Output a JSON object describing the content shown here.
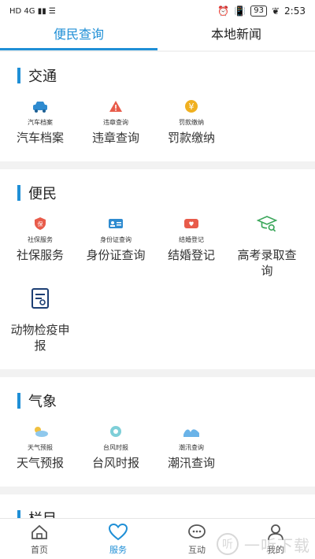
{
  "status": {
    "left": "HD 4G ▮▮ ☰",
    "time": "2:53",
    "battery": "93"
  },
  "tabs": [
    {
      "label": "便民查询",
      "active": true
    },
    {
      "label": "本地新闻",
      "active": false
    }
  ],
  "sections": {
    "traffic": {
      "title": "交通",
      "items": [
        {
          "small": "汽车档案",
          "label": "汽车档案",
          "icon": "car-icon"
        },
        {
          "small": "违章查询",
          "label": "违章查询",
          "icon": "warning-icon"
        },
        {
          "small": "罚款缴纳",
          "label": "罚款缴纳",
          "icon": "yuan-icon"
        }
      ]
    },
    "convenience": {
      "title": "便民",
      "items": [
        {
          "small": "社保服务",
          "label": "社保服务",
          "icon": "social-security-icon"
        },
        {
          "small": "身份证查询",
          "label": "身份证查询",
          "icon": "id-card-icon"
        },
        {
          "small": "结婚登记",
          "label": "结婚登记",
          "icon": "marriage-icon"
        },
        {
          "small": "",
          "label": "高考录取查询",
          "icon": "graduation-cap-icon"
        },
        {
          "small": "",
          "label": "动物检疫申报",
          "icon": "document-icon"
        }
      ]
    },
    "weather": {
      "title": "气象",
      "items": [
        {
          "small": "天气预报",
          "label": "天气预报",
          "icon": "weather-icon"
        },
        {
          "small": "台风时报",
          "label": "台风时报",
          "icon": "typhoon-icon"
        },
        {
          "small": "潮汛查询",
          "label": "潮汛查询",
          "icon": "wave-icon"
        }
      ]
    },
    "columns": {
      "title": "栏目"
    }
  },
  "nav": [
    {
      "label": "首页",
      "icon": "home-icon",
      "active": false
    },
    {
      "label": "服务",
      "icon": "heart-icon",
      "active": true
    },
    {
      "label": "互动",
      "icon": "chat-icon",
      "active": false
    },
    {
      "label": "我的",
      "icon": "user-icon",
      "active": false
    }
  ],
  "watermark": {
    "text": "一听下载"
  },
  "colors": {
    "accent": "#1f8fd6",
    "warning": "#e85b4a",
    "yuan": "#f0b020",
    "green": "#3aa65a"
  }
}
